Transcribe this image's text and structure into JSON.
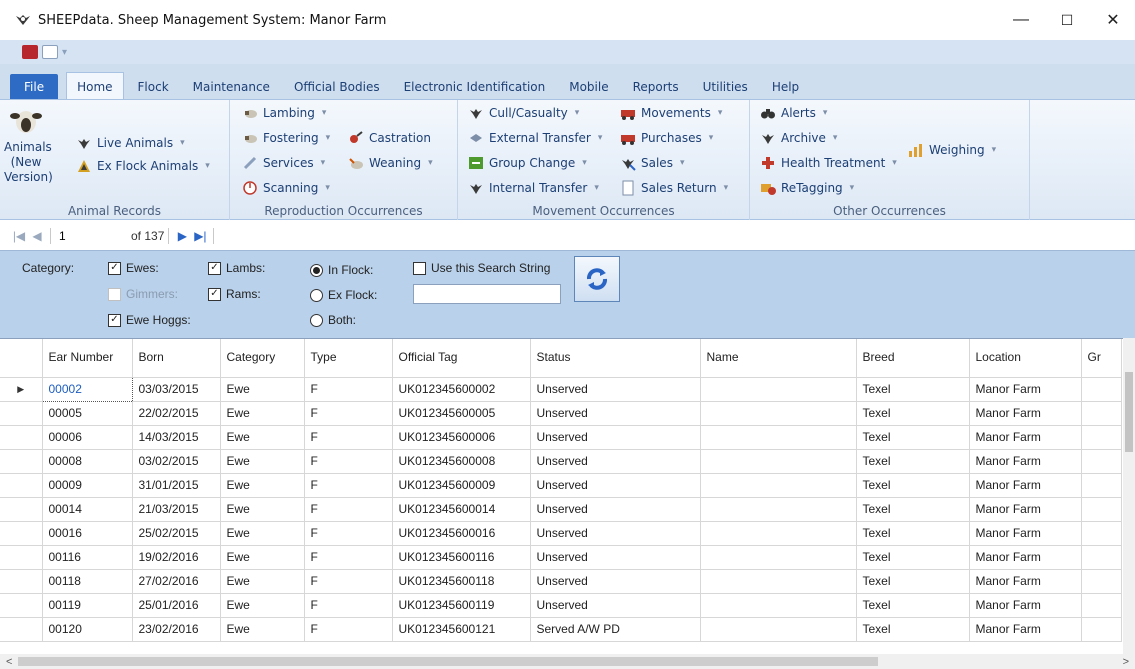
{
  "window": {
    "title": "SHEEPdata. Sheep Management System: Manor Farm",
    "minimize": "—",
    "maximize": "☐",
    "close": "✕"
  },
  "ribbon": {
    "tabs": [
      "File",
      "Home",
      "Flock",
      "Maintenance",
      "Official Bodies",
      "Electronic Identification",
      "Mobile",
      "Reports",
      "Utilities",
      "Help"
    ],
    "active_tab": "Home",
    "groups": {
      "animal_records": {
        "label": "Animal Records",
        "big_button": "Animals (New Version)",
        "items": [
          "Live Animals",
          "Ex Flock Animals"
        ]
      },
      "reproduction": {
        "label": "Reproduction Occurrences",
        "items": [
          "Lambing",
          "Fostering",
          "Services",
          "Scanning",
          "Castration",
          "Weaning"
        ]
      },
      "movement": {
        "label": "Movement Occurrences",
        "items": [
          "Cull/Casualty",
          "External Transfer",
          "Group Change",
          "Internal Transfer",
          "Movements",
          "Purchases",
          "Sales",
          "Sales Return"
        ]
      },
      "other": {
        "label": "Other Occurrences",
        "items": [
          "Alerts",
          "Archive",
          "Health Treatment",
          "ReTagging",
          "Weighing"
        ]
      }
    }
  },
  "navigator": {
    "position": "1",
    "of_label": "of 137"
  },
  "filter": {
    "category_label": "Category:",
    "checkboxes": {
      "ewes": "Ewes:",
      "gimmers": "Gimmers:",
      "ewe_hoggs": "Ewe Hoggs:",
      "lambs": "Lambs:",
      "rams": "Rams:"
    },
    "radios": {
      "in_flock": "In Flock:",
      "ex_flock": "Ex Flock:",
      "both": "Both:"
    },
    "search_string_label": "Use this Search String",
    "search_value": ""
  },
  "grid": {
    "columns": [
      "Ear Number",
      "Born",
      "Category",
      "Type",
      "Official Tag",
      "Status",
      "Name",
      "Breed",
      "Location",
      "Gr"
    ],
    "rows": [
      [
        "00002",
        "03/03/2015",
        "Ewe",
        "F",
        "UK012345600002",
        "Unserved",
        "",
        "Texel",
        "Manor Farm",
        ""
      ],
      [
        "00005",
        "22/02/2015",
        "Ewe",
        "F",
        "UK012345600005",
        "Unserved",
        "",
        "Texel",
        "Manor Farm",
        ""
      ],
      [
        "00006",
        "14/03/2015",
        "Ewe",
        "F",
        "UK012345600006",
        "Unserved",
        "",
        "Texel",
        "Manor Farm",
        ""
      ],
      [
        "00008",
        "03/02/2015",
        "Ewe",
        "F",
        "UK012345600008",
        "Unserved",
        "",
        "Texel",
        "Manor Farm",
        ""
      ],
      [
        "00009",
        "31/01/2015",
        "Ewe",
        "F",
        "UK012345600009",
        "Unserved",
        "",
        "Texel",
        "Manor Farm",
        ""
      ],
      [
        "00014",
        "21/03/2015",
        "Ewe",
        "F",
        "UK012345600014",
        "Unserved",
        "",
        "Texel",
        "Manor Farm",
        ""
      ],
      [
        "00016",
        "25/02/2015",
        "Ewe",
        "F",
        "UK012345600016",
        "Unserved",
        "",
        "Texel",
        "Manor Farm",
        ""
      ],
      [
        "00116",
        "19/02/2016",
        "Ewe",
        "F",
        "UK012345600116",
        "Unserved",
        "",
        "Texel",
        "Manor Farm",
        ""
      ],
      [
        "00118",
        "27/02/2016",
        "Ewe",
        "F",
        "UK012345600118",
        "Unserved",
        "",
        "Texel",
        "Manor Farm",
        ""
      ],
      [
        "00119",
        "25/01/2016",
        "Ewe",
        "F",
        "UK012345600119",
        "Unserved",
        "",
        "Texel",
        "Manor Farm",
        ""
      ],
      [
        "00120",
        "23/02/2016",
        "Ewe",
        "F",
        "UK012345600121",
        "Served A/W PD",
        "",
        "Texel",
        "Manor Farm",
        ""
      ]
    ]
  }
}
